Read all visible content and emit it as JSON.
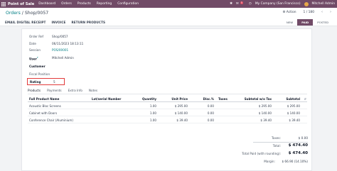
{
  "topbar": {
    "app_name": "Point of Sale",
    "nav": [
      "Dashboard",
      "Orders",
      "Products",
      "Reporting",
      "Configuration"
    ],
    "chat_count": "5",
    "company": "My Company (San Francisco)",
    "user": "Mitchell Admin"
  },
  "breadcrumb": {
    "parent": "Orders",
    "separator": " / ",
    "current": "Shop/0057"
  },
  "header_actions": {
    "action_label": "Action",
    "pager": "1 / 180"
  },
  "buttons": [
    "EMAIL DIGITAL RECEIPT",
    "INVOICE",
    "RETURN PRODUCTS"
  ],
  "status": {
    "stages": [
      "NEW",
      "PAID",
      "POSTED"
    ],
    "active": "PAID"
  },
  "fields": {
    "order_ref_label": "Order Ref",
    "order_ref": "Shop/0057",
    "date_label": "Date",
    "date": "06/11/2023 18:13:11",
    "session_label": "Session",
    "session": "POS/00001",
    "user_label": "User",
    "user_help": "?",
    "user": "Mitchell Admin",
    "customer_label": "Customer",
    "fiscal_position_label": "Fiscal Position",
    "rating_label": "Rating",
    "rating": "5"
  },
  "tabs": [
    "Products",
    "Payments",
    "Extra Info",
    "Notes"
  ],
  "table": {
    "headers": [
      "Full Product Name",
      "Lot/serial Number",
      "Quantity",
      "Unit Price",
      "Disc.%",
      "Taxes",
      "Subtotal w/o Tax",
      "Subtotal"
    ],
    "rows": [
      {
        "name": "Acoustic Bloc Screens",
        "qty": "1.00",
        "price": "$ 295.00",
        "disc": "0.00",
        "taxes": "",
        "subtotal_wo": "$ 295.00",
        "subtotal": "$ 295.00"
      },
      {
        "name": "Cabinet with Doors",
        "qty": "1.00",
        "price": "$ 140.00",
        "disc": "0.00",
        "taxes": "",
        "subtotal_wo": "$ 140.00",
        "subtotal": "$ 140.00"
      },
      {
        "name": "Conference Chair (Aluminium)",
        "qty": "1.00",
        "price": "$ 39.40",
        "disc": "0.00",
        "taxes": "",
        "subtotal_wo": "$ 39.40",
        "subtotal": "$ 39.40"
      }
    ]
  },
  "totals": {
    "taxes_label": "Taxes:",
    "taxes": "$ 0.00",
    "total_label": "Total:",
    "total": "$ 474.40",
    "paid_label": "Total Paid (with rounding):",
    "paid": "$ 474.40",
    "margin_label": "Margin:",
    "margin": "$ 66.90 (14.10%)"
  },
  "colors": {
    "brand": "#714b67",
    "link": "#017e84",
    "highlight": "#e23b3b"
  }
}
